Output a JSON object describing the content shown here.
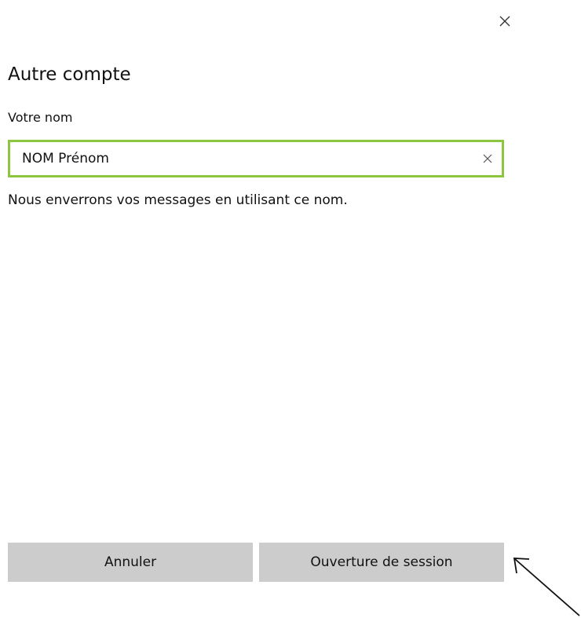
{
  "dialog": {
    "close_icon": "close-icon",
    "title": "Autre compte"
  },
  "name_field": {
    "label": "Votre nom",
    "value": "NOM Prénom",
    "clear_icon": "clear-icon",
    "focus_color": "#8cc63f"
  },
  "hint": "Nous enverrons vos messages en utilisant ce nom.",
  "buttons": {
    "cancel_label": "Annuler",
    "signin_label": "Ouverture de session",
    "background_color": "#cccccc"
  },
  "annotation": {
    "icon": "arrow-annotation-icon"
  }
}
